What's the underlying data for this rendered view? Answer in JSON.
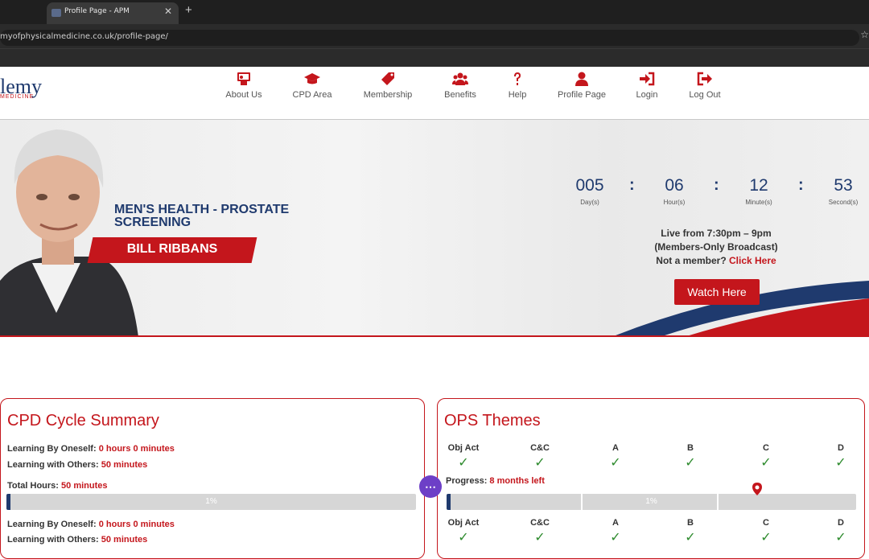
{
  "browser": {
    "tab_title": "Profile Page - APM",
    "tab_close": "✕",
    "new_tab": "+",
    "url": "myofphysicalmedicine.co.uk/profile-page/",
    "star": "☆"
  },
  "site": {
    "logo_main": "lemy",
    "logo_sub": "MEDICINE"
  },
  "nav": {
    "items": [
      {
        "label": "About Us",
        "icon": "presentation-icon"
      },
      {
        "label": "CPD Area",
        "icon": "graduation-cap-icon"
      },
      {
        "label": "Membership",
        "icon": "tag-icon"
      },
      {
        "label": "Benefits",
        "icon": "users-icon"
      },
      {
        "label": "Help",
        "icon": "question-icon"
      },
      {
        "label": "Profile Page",
        "icon": "user-icon"
      },
      {
        "label": "Login",
        "icon": "sign-in-icon"
      },
      {
        "label": "Log Out",
        "icon": "sign-out-icon"
      }
    ]
  },
  "hero": {
    "title_line1": "MEN'S HEALTH - PROSTATE",
    "title_line2": "SCREENING",
    "speaker": "BILL RIBBANS",
    "countdown": [
      {
        "value": "005",
        "label": "Day(s)"
      },
      {
        "value": "06",
        "label": "Hour(s)"
      },
      {
        "value": "12",
        "label": "Minute(s)"
      },
      {
        "value": "53",
        "label": "Second(s)"
      }
    ],
    "separator": ":",
    "live_line1": "Live from 7:30pm – 9pm",
    "live_line2": "(Members-Only Broadcast)",
    "not_member": "Not a member?",
    "click_here": "Click Here",
    "watch_button": "Watch Here"
  },
  "cpd": {
    "title": "CPD Cycle Summary",
    "oneself_label": "Learning By Oneself:",
    "oneself_value": "0 hours 0 minutes",
    "others_label": "Learning with Others:",
    "others_value": "50 minutes",
    "total_label": "Total Hours:",
    "total_value": "50 minutes",
    "progress_text": "1%",
    "progress_fraction": 0.01,
    "oneself_label_2": "Learning By Oneself:",
    "oneself_value_2": "0 hours 0 minutes",
    "others_label_2": "Learning with Others:",
    "others_value_2": "50 minutes"
  },
  "ops": {
    "title": "OPS Themes",
    "columns": [
      "Obj Act",
      "C&C",
      "A",
      "B",
      "C",
      "D"
    ],
    "check": "✓",
    "progress_label": "Progress:",
    "progress_value": "8 months left",
    "progress_text": "1%",
    "progress_fraction": 0.01,
    "columns_2": [
      "Obj Act",
      "C&C",
      "A",
      "B",
      "C",
      "D"
    ]
  },
  "fab_label": "⋯",
  "colors": {
    "brand_red": "#c4161c",
    "brand_navy": "#1f3a6e",
    "check_green": "#2e8b2e",
    "fab_purple": "#6d3fc7"
  }
}
